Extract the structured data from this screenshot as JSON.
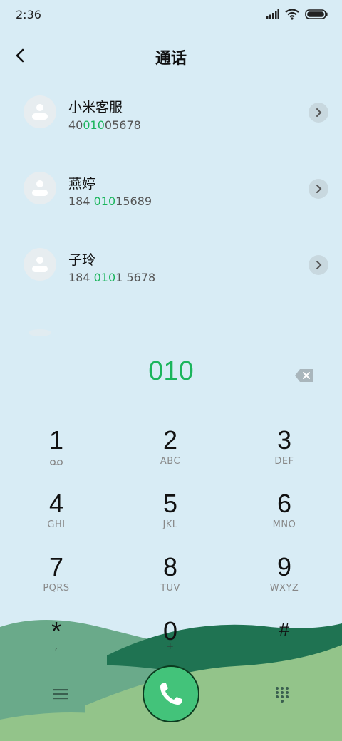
{
  "status": {
    "time": "2:36"
  },
  "header": {
    "title": "通话"
  },
  "contacts": [
    {
      "name": "小米客服",
      "num_pre": "40",
      "num_hl": "010",
      "num_post": "05678"
    },
    {
      "name": "燕婷",
      "num_pre": "184 ",
      "num_hl": "010",
      "num_post": "15689"
    },
    {
      "name": "子玲",
      "num_pre": "184 ",
      "num_hl": "010",
      "num_post": "1 5678"
    }
  ],
  "dialer": {
    "input": "010",
    "keys": [
      {
        "digit": "1",
        "letters": ""
      },
      {
        "digit": "2",
        "letters": "ABC"
      },
      {
        "digit": "3",
        "letters": "DEF"
      },
      {
        "digit": "4",
        "letters": "GHI"
      },
      {
        "digit": "5",
        "letters": "JKL"
      },
      {
        "digit": "6",
        "letters": "MNO"
      },
      {
        "digit": "7",
        "letters": "PQRS"
      },
      {
        "digit": "8",
        "letters": "TUV"
      },
      {
        "digit": "9",
        "letters": "WXYZ"
      },
      {
        "digit": "*",
        "letters": ","
      },
      {
        "digit": "0",
        "letters": "+"
      },
      {
        "digit": "#",
        "letters": ""
      }
    ]
  },
  "colors": {
    "accent": "#1bb55c",
    "call": "#43c37a",
    "background": "#d8ecf5"
  },
  "icons": {
    "back": "back-arrow-icon",
    "chevron": "chevron-right-icon",
    "backspace": "backspace-icon",
    "voicemail": "voicemail-icon",
    "call": "phone-icon",
    "menu": "menu-icon",
    "dialpad": "dialpad-icon"
  }
}
